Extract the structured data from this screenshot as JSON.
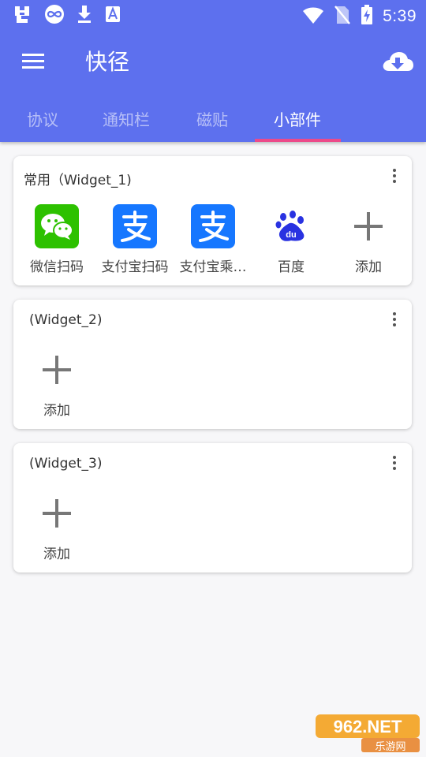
{
  "status_bar": {
    "time": "5:39",
    "left_icons": [
      "bug-icon",
      "infinity-icon",
      "download-icon",
      "font-icon"
    ],
    "right_icons": [
      "wifi-icon",
      "no-sim-icon",
      "battery-charging-icon"
    ]
  },
  "toolbar": {
    "title": "快径",
    "menu_icon": "hamburger-menu-icon",
    "action_icon": "cloud-download-icon"
  },
  "tabs": [
    {
      "label": "协议",
      "active": false
    },
    {
      "label": "通知栏",
      "active": false
    },
    {
      "label": "磁贴",
      "active": false
    },
    {
      "label": "小部件",
      "active": true
    }
  ],
  "widgets": [
    {
      "title": "常用（Widget_1)",
      "items": [
        {
          "label": "微信扫码",
          "icon": "wechat-icon"
        },
        {
          "label": "支付宝扫码",
          "icon": "alipay-icon"
        },
        {
          "label": "支付宝乘…",
          "icon": "alipay-icon"
        },
        {
          "label": "百度",
          "icon": "baidu-icon"
        },
        {
          "label": "添加",
          "icon": "plus-icon"
        }
      ]
    },
    {
      "title": "(Widget_2)",
      "items": [
        {
          "label": "添加",
          "icon": "plus-icon"
        }
      ]
    },
    {
      "title": "(Widget_3)",
      "items": [
        {
          "label": "添加",
          "icon": "plus-icon"
        }
      ]
    }
  ],
  "watermark": {
    "text_top": "962.NET",
    "text_bottom": "乐游网"
  },
  "colors": {
    "primary": "#5d70ee",
    "tab_indicator": "#ec4a8a",
    "wechat": "#2dc100",
    "alipay": "#1677ff",
    "baidu": "#2932e1",
    "background": "#f7f7f9"
  }
}
